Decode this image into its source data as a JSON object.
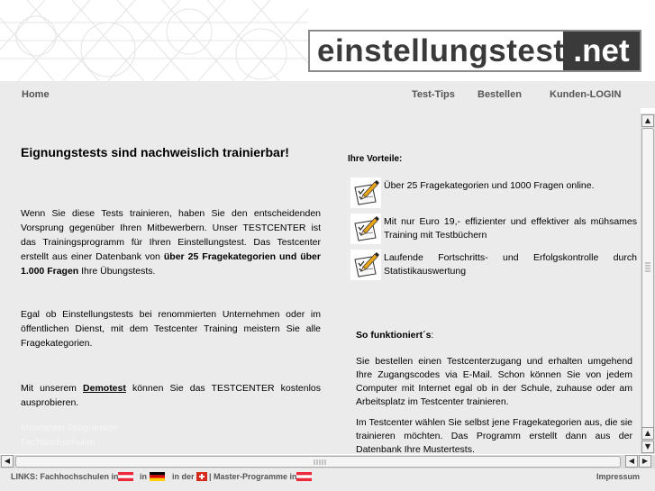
{
  "header": {
    "logo_name": "einstellungstest",
    "logo_tld": ".net"
  },
  "nav": {
    "home": "Home",
    "test_tips": "Test-Tips",
    "bestellen": "Bestellen",
    "kunden_login": "Kunden-LOGIN"
  },
  "main": {
    "headline": "Eignungstests sind nachweislich trainierbar!",
    "para1_start": "Wenn Sie diese Tests trainieren, haben Sie den entscheidenden Vorsprung gegenüber Ihren Mitbewerbern. Unser TESTCENTER ist das Trainingsprogramm für Ihren Einstellungstest. Das Testcenter erstellt aus einer Datenbank von ",
    "para1_bold": "über 25 Fragekategorien und über 1.000 Fragen",
    "para1_end": " Ihre Übungstests.",
    "para2": "Egal ob Einstellungstests bei renommierten Unternehmen oder im öffentlichen Dienst, mit dem Testcenter Training meistern Sie alle Fragekategorien.",
    "para3_start": "Mit unserem ",
    "para3_link": "Demotest",
    "para3_end": " können Sie das TESTCENTER kostenlos ausprobieren.",
    "hidden_link1": "Mitarbeiter Programme",
    "hidden_link2": "Fachhochschulen"
  },
  "vorteile": {
    "title": "Ihre Vorteile:",
    "items": [
      "Über 25 Fragekategorien und 1000 Fragen online.",
      "Mit nur Euro 19,- effizienter und effektiver als mühsames Training mit Testbüchern",
      "Laufende Fortschritts- und Erfolgskontrolle durch Statistikauswertung"
    ],
    "icon": "checklist-pencil-icon"
  },
  "funktion": {
    "title": "So funktioniert´s",
    "title_suffix": ":",
    "para1": "Sie bestellen einen Testcenterzugang und erhalten umgehend Ihre Zugangscodes via E-Mail. Schon können Sie von jedem Computer mit Internet egal ob in der Schule, zuhause oder am Arbeitsplatz im Testcenter trainieren.",
    "para2": "Im Testcenter wählen Sie selbst jene Fragekategorien aus, die sie trainieren möchten. Das Programm erstellt dann aus der Datenbank Ihre Mustertests."
  },
  "footer": {
    "links_label": "LINKS: Fachhochschulen in",
    "in_label": "in",
    "in_der_label": "in der",
    "master_label": "| Master-Programme in",
    "impressum": "Impressum"
  },
  "colors": {
    "background": "#ebebeb",
    "logo_dark": "#3a3a3a",
    "nav_text": "#555555"
  }
}
